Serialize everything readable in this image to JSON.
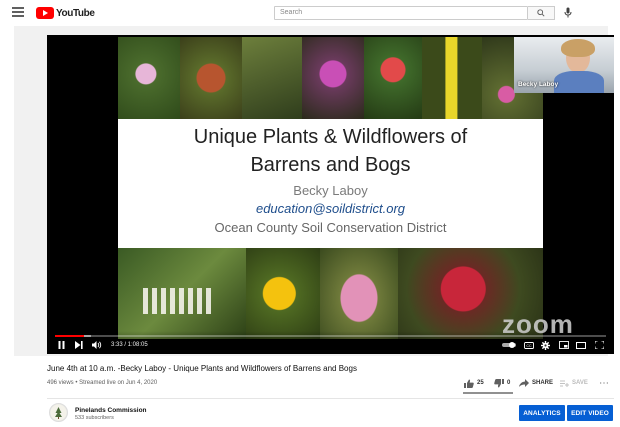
{
  "app": {
    "logo_text": "YouTube"
  },
  "search": {
    "placeholder": "Search"
  },
  "slide": {
    "title_line1": "Unique Plants & Wildflowers of",
    "title_line2": "Barrens and Bogs",
    "presenter": "Becky Laboy",
    "email": "education@soildistrict.org",
    "organization": "Ocean County Soil Conservation District",
    "title_color": "#222222",
    "presenter_color": "#7a7a7a",
    "email_color": "#1f4e8c",
    "org_color": "#666666"
  },
  "webcam": {
    "participant_name": "Becky Laboy"
  },
  "watermark": {
    "text": "zoom"
  },
  "player": {
    "current_time": "3:33",
    "duration": "1:08:05",
    "time_display": "3:33 / 1:08:05",
    "progress_fraction": 0.052,
    "buffered_fraction": 0.065,
    "accent_color": "#ff0000"
  },
  "video": {
    "title": "June 4th at 10 a.m. -Becky Laboy - Unique Plants and Wildflowers of Barrens and Bogs",
    "meta": "496 views • Streamed live on Jun 4, 2020",
    "likes": "25",
    "dislikes": "0",
    "share_label": "SHARE",
    "save_label": "SAVE"
  },
  "channel": {
    "name": "Pinelands Commission",
    "subscribers": "533 subscribers"
  },
  "buttons": {
    "analytics": "ANALYTICS",
    "edit_video": "EDIT VIDEO",
    "brand_color": "#065fd4"
  }
}
